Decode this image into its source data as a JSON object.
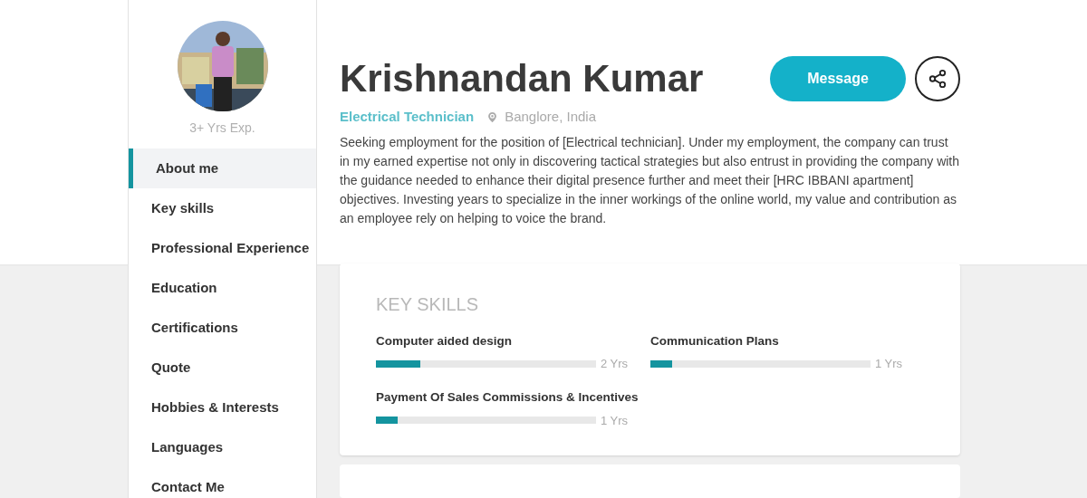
{
  "profile": {
    "experience": "3+ Yrs Exp.",
    "name": "Krishnandan Kumar",
    "title": "Electrical Technician",
    "location": "Banglore, India",
    "summary": "Seeking employment for the position of [Electrical technician]. Under my employment, the company can trust in my earned expertise not only in discovering tactical strategies but also entrust in providing the company with the guidance needed to enhance their digital presence further and meet their [HRC IBBANI apartment] objectives. Investing years to specialize in the inner workings of the online world, my value and contribution as an employee rely on helping to voice the brand."
  },
  "buttons": {
    "message": "Message"
  },
  "sidebar": {
    "items": [
      {
        "label": "About me",
        "selected": true
      },
      {
        "label": "Key skills",
        "selected": false
      },
      {
        "label": "Professional Experience",
        "selected": false
      },
      {
        "label": "Education",
        "selected": false
      },
      {
        "label": "Certifications",
        "selected": false
      },
      {
        "label": "Quote",
        "selected": false
      },
      {
        "label": "Hobbies & Interests",
        "selected": false
      },
      {
        "label": "Languages",
        "selected": false
      },
      {
        "label": "Contact Me",
        "selected": false
      }
    ]
  },
  "key_skills": {
    "title": "KEY SKILLS",
    "skills": [
      {
        "name": "Computer aided design",
        "level": 0.2,
        "reading": "2 Yrs"
      },
      {
        "name": "Communication Plans",
        "level": 0.1,
        "reading": "1 Yrs"
      },
      {
        "name": "Payment Of Sales Commissions & Incentives",
        "level": 0.1,
        "reading": "1 Yrs"
      }
    ]
  }
}
